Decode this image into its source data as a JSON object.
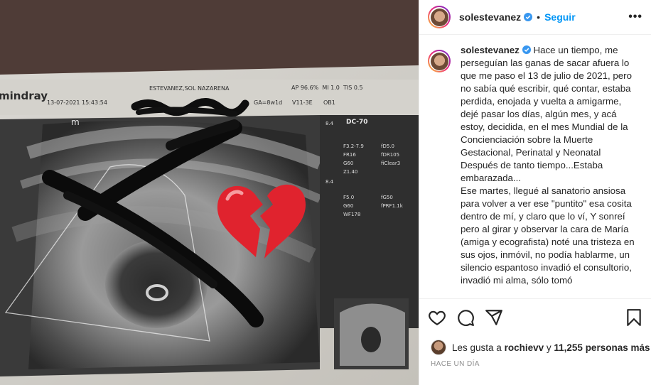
{
  "post": {
    "username": "solestevanez",
    "follow_label": "Seguir",
    "separator": "•",
    "more_label": "•••",
    "caption": "Hace un tiempo, me perseguían las ganas de sacar afuera lo que me paso el 13 de julio de 2021, pero no sabía qué escribir, qué contar, estaba perdida, enojada y vuelta a amigarme, dejé pasar los días, algún mes, y acá estoy, decidida, en el mes Mundial de la Concienciación sobre la Muerte Gestacional, Perinatal y Neonatal\nDespués de tanto tiempo...Estaba embarazada...\nEse martes, llegué al sanatorio ansiosa para volver a ver ese \"puntito\" esa cosita dentro de mí, y claro que lo ví, Y sonreí pero al girar y observar la cara de María (amiga y ecografista) noté una tristeza en sus ojos, inmóvil, no podía hablarme, un silencio espantoso invadió el consultorio, invadió mi alma, sólo tomó",
    "likes_prefix": "Les gusta a",
    "likes_user": "rochievv",
    "likes_mid": "y",
    "likes_count": "11,255 personas más",
    "time_ago": "HACE UN DÍA"
  },
  "ultrasound": {
    "brand": "mindray",
    "datetime": "13-07-2021 15:43:54",
    "patient": "ESTEVANEZ,SOL NAZARENA",
    "ap": "AP 96.6%  MI 1.0  TIS 0.5",
    "ga": "GA=8w1d",
    "probe": "V11-3E",
    "ob": "OB1",
    "dc": "DC-70",
    "params_a": [
      "F3.2-7.9",
      "FR16",
      "G60",
      "Z1.40"
    ],
    "params_b": [
      "fD5.0",
      "fDR105",
      "fiClear3"
    ],
    "params_c": [
      "F5.0",
      "G60",
      "WF178"
    ],
    "params_d": [
      "fG50",
      "fPRF1.1k"
    ],
    "scale_top": "8.4",
    "scale_bottom": "8.4",
    "marker": "m"
  },
  "colors": {
    "accent": "#0095f6",
    "verified": "#3897f0",
    "heart": "#e0232e"
  },
  "icons": [
    "verified-badge-icon",
    "heart-icon",
    "comment-icon",
    "share-icon",
    "bookmark-icon",
    "broken-heart-icon"
  ]
}
